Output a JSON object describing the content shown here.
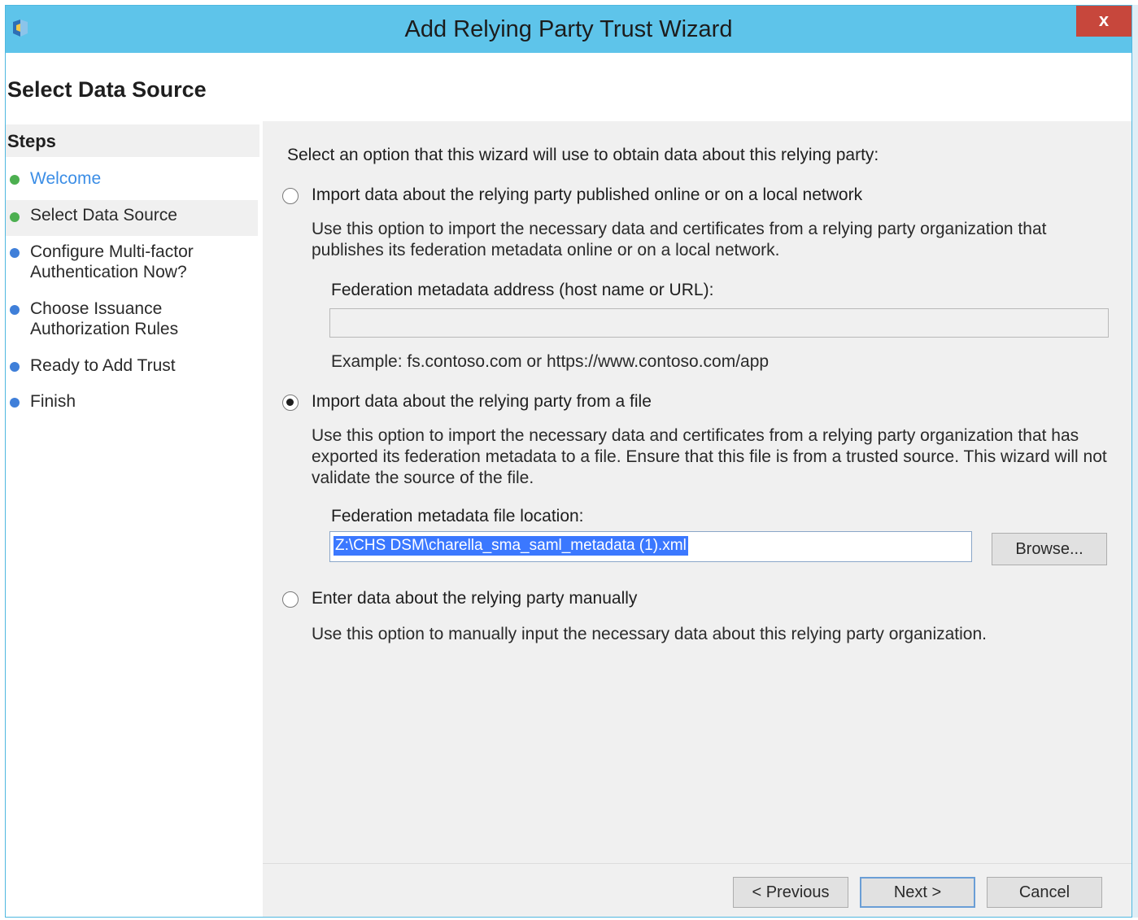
{
  "window": {
    "title": "Add Relying Party Trust Wizard",
    "close_label": "x"
  },
  "page_title": "Select Data Source",
  "sidebar": {
    "header": "Steps",
    "items": [
      {
        "label": "Welcome",
        "status": "completed",
        "color": "#4caf50"
      },
      {
        "label": "Select Data Source",
        "status": "current",
        "color": "#4caf50"
      },
      {
        "label": "Configure Multi-factor Authentication Now?",
        "status": "pending",
        "color": "#3f7fd9"
      },
      {
        "label": "Choose Issuance Authorization Rules",
        "status": "pending",
        "color": "#3f7fd9"
      },
      {
        "label": "Ready to Add Trust",
        "status": "pending",
        "color": "#3f7fd9"
      },
      {
        "label": "Finish",
        "status": "pending",
        "color": "#3f7fd9"
      }
    ]
  },
  "main": {
    "intro": "Select an option that this wizard will use to obtain data about this relying party:",
    "option_online": {
      "label": "Import data about the relying party published online or on a local network",
      "selected": false,
      "description": "Use this option to import the necessary data and certificates from a relying party organization that publishes its federation metadata online or on a local network.",
      "field_label": "Federation metadata address (host name or URL):",
      "field_value": "",
      "example": "Example: fs.contoso.com or https://www.contoso.com/app"
    },
    "option_file": {
      "label": "Import data about the relying party from a file",
      "selected": true,
      "description": "Use this option to import the necessary data and certificates from a relying party organization that has exported its federation metadata to a file. Ensure that this file is from a trusted source.  This wizard will not validate the source of the file.",
      "field_label": "Federation metadata file location:",
      "field_value": "Z:\\CHS DSM\\charella_sma_saml_metadata (1).xml",
      "browse_label": "Browse..."
    },
    "option_manual": {
      "label": "Enter data about the relying party manually",
      "selected": false,
      "description": "Use this option to manually input the necessary data about this relying party organization."
    }
  },
  "footer": {
    "previous_label": "< Previous",
    "next_label": "Next >",
    "cancel_label": "Cancel"
  }
}
